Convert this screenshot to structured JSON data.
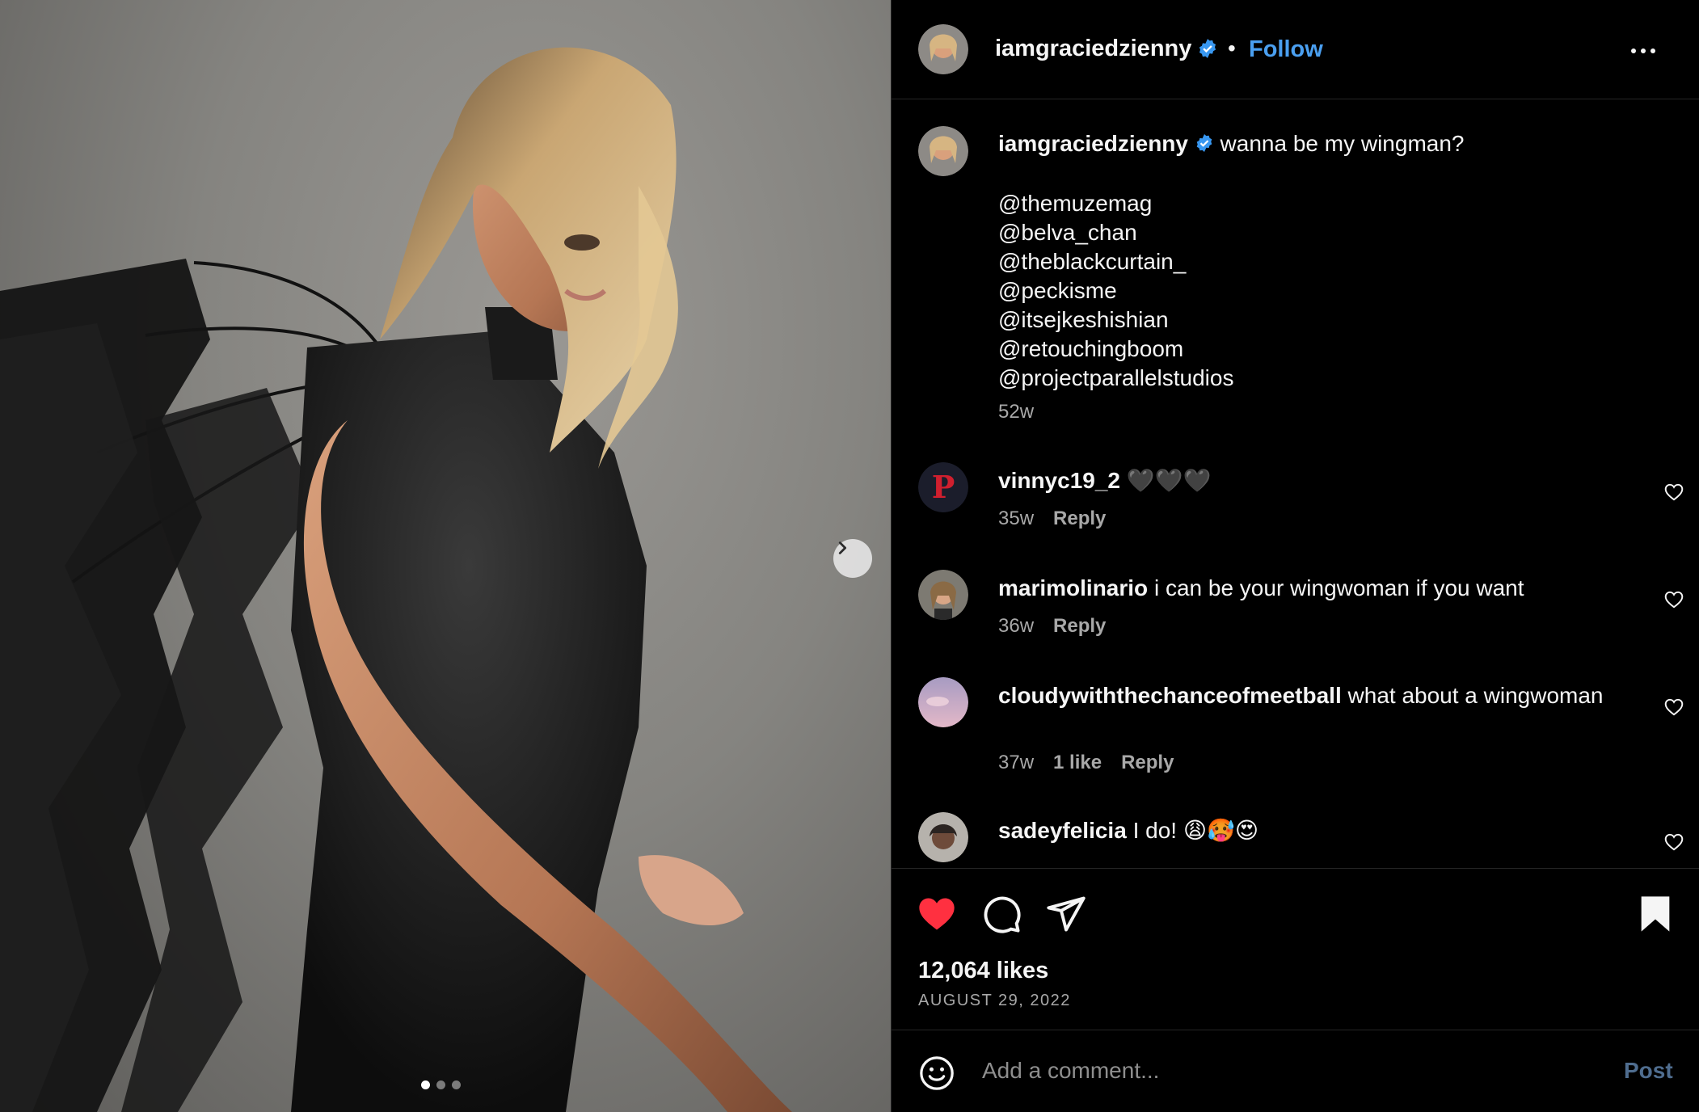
{
  "post": {
    "author": "iamgraciedzienny",
    "verified": true,
    "follow_label": "Follow",
    "separator": "•",
    "image_alt": "photo of woman in black outfit with dark wings",
    "carousel": {
      "slides": 3,
      "active": 1
    }
  },
  "caption": {
    "username": "iamgraciedzienny",
    "text": "wanna be my wingman?",
    "mentions": [
      "@themuzemag",
      "@belva_chan",
      "@theblackcurtain_",
      "@peckisme",
      "@itsejkeshishian",
      "@retouchingboom",
      "@projectparallelstudios"
    ],
    "time": "52w"
  },
  "comments": [
    {
      "username": "vinnyc19_2",
      "text": "🖤🖤🖤",
      "time": "35w",
      "likes": "",
      "reply": "Reply"
    },
    {
      "username": "marimolinario",
      "text": "i can be your wingwoman if you want",
      "time": "36w",
      "likes": "",
      "reply": "Reply"
    },
    {
      "username": "cloudywiththechanceofmeetball",
      "text": "what about a wingwoman",
      "time": "37w",
      "likes": "1 like",
      "reply": "Reply"
    },
    {
      "username": "sadeyfelicia",
      "text": "I do! 😩🥵😍",
      "time": "",
      "likes": "",
      "reply": ""
    }
  ],
  "stats": {
    "likes": "12,064 likes",
    "date": "AUGUST 29, 2022",
    "liked": true,
    "saved": true
  },
  "add_comment": {
    "placeholder": "Add a comment...",
    "post_label": "Post"
  },
  "colors": {
    "background": "#000000",
    "link_blue": "#4a9ff0",
    "like_red": "#ff3040",
    "muted": "#a8a8a8",
    "post_disabled": "#4f6d8f"
  },
  "icons": [
    "verified-badge-icon",
    "more-options-icon",
    "chevron-right-icon",
    "heart-icon",
    "comment-icon",
    "share-icon",
    "bookmark-icon",
    "emoji-icon"
  ]
}
